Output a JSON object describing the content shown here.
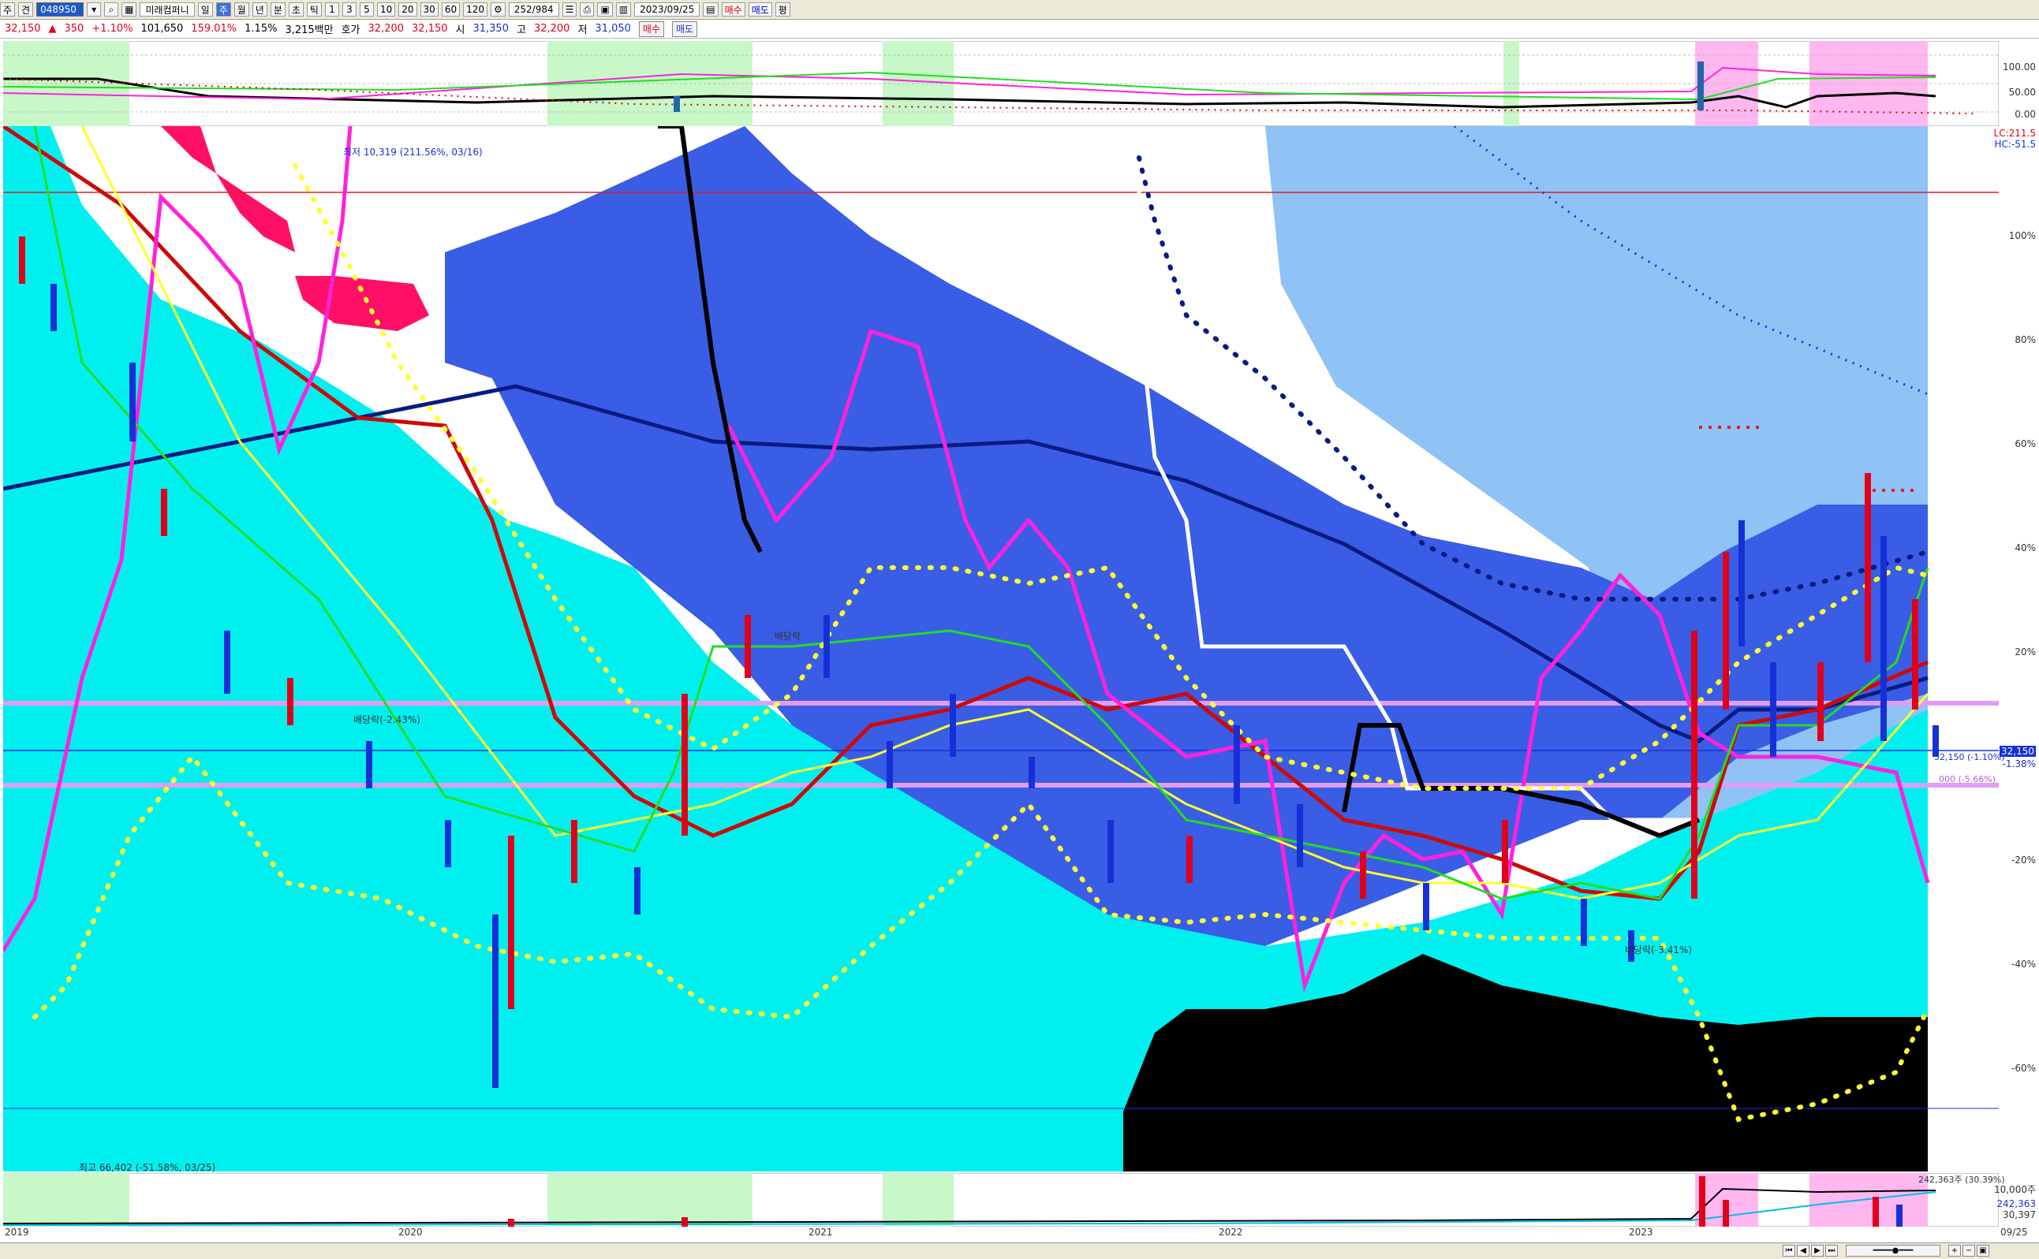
{
  "toolbar": {
    "items": [
      "주",
      "견"
    ],
    "code": "048950",
    "name": "미래컴퍼니",
    "periods": [
      "일",
      "주",
      "월",
      "년",
      "분",
      "초",
      "틱"
    ],
    "active_period": "주",
    "intervals": [
      "1",
      "3",
      "5",
      "10",
      "20",
      "30",
      "60",
      "120"
    ],
    "count": "252",
    "total": "984",
    "date": "2023/09/25",
    "buy_label": "매수",
    "sell_label": "매도",
    "extra_label": "평"
  },
  "quote": {
    "price": "32,150",
    "change": "350",
    "change_pct": "+1.10%",
    "volume": "101,650",
    "vol_ratio": "159.01%",
    "turnover": "1.15%",
    "amount": "3,215백만",
    "ask_label": "호가",
    "ask": "32,200",
    "bid": "32,150",
    "open_label": "시",
    "open": "31,350",
    "high_label": "고",
    "high": "32,200",
    "low_label": "저",
    "low": "31,050",
    "buy_label": "매수",
    "sell_label": "매도"
  },
  "indicator_axis": [
    "100.00",
    "50.00",
    "0.00"
  ],
  "price_axis": [
    "LC:211.5",
    "HC:-51.5",
    "100%",
    "80%",
    "60%",
    "40%",
    "20%",
    "-20%",
    "-40%",
    "-60%"
  ],
  "price_tag": "32,150",
  "price_tag_pct": "-1.38%",
  "volume_axis": [
    "10,000주",
    "242,363",
    "30,397"
  ],
  "annotations": {
    "low_note": "최저 10,319 (211.56%, 03/16)",
    "high_note": "최고 66,402 (-51.58%, 03/25)",
    "div1": "배당락",
    "div2": "배당락(-2.43%)",
    "div3": "배당락(-3.41%)",
    "cur_line": "32,150 (-1.10%)",
    "box_line": "000 (-5.66%)",
    "vol_note": "242,363주 (30.39%)"
  },
  "dates": [
    "2019",
    "2020",
    "2021",
    "2022",
    "2023",
    "09/25"
  ],
  "colors": {
    "cyan_cloud": "#00f0f0",
    "blue_cloud": "#3a5de6",
    "light_blue": "#8fc2f5",
    "magenta": "#ff22dd",
    "dark_red": "#cc0a0a",
    "navy": "#0a1b80",
    "yellow": "#ffff33",
    "green": "#22dd22",
    "pink": "#ff1066",
    "black": "#000000"
  }
}
